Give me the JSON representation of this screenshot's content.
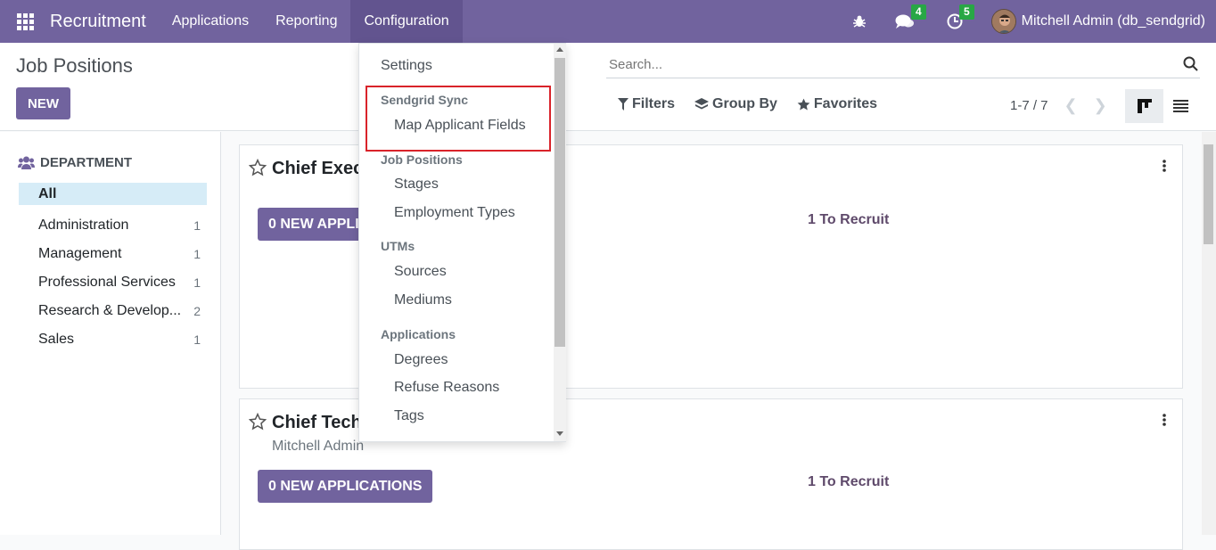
{
  "navbar": {
    "brand": "Recruitment",
    "menus": [
      "Applications",
      "Reporting",
      "Configuration"
    ],
    "messages_count": "4",
    "activities_count": "5",
    "user": "Mitchell Admin (db_sendgrid)"
  },
  "control": {
    "title": "Job Positions",
    "new_label": "NEW",
    "search_placeholder": "Search...",
    "filters": "Filters",
    "group_by": "Group By",
    "favorites": "Favorites",
    "pager": "1-7 / 7"
  },
  "sidebar": {
    "heading": "DEPARTMENT",
    "items": [
      {
        "label": "All",
        "count": ""
      },
      {
        "label": "Administration",
        "count": "1"
      },
      {
        "label": "Management",
        "count": "1"
      },
      {
        "label": "Professional Services",
        "count": "1"
      },
      {
        "label": "Research & Develop...",
        "count": "2"
      },
      {
        "label": "Sales",
        "count": "1"
      }
    ]
  },
  "cards": [
    {
      "title": "Chief Executive Officer",
      "subtitle": "",
      "button": "0 NEW APPLICATIONS",
      "recruit": "1 To Recruit"
    },
    {
      "title": "Chief Technical Officer",
      "subtitle": "Mitchell Admin",
      "button": "0 NEW APPLICATIONS",
      "recruit": "1 To Recruit"
    }
  ],
  "dropdown": {
    "settings": "Settings",
    "sendgrid_head": "Sendgrid Sync",
    "map_fields": "Map Applicant Fields",
    "jobpos_head": "Job Positions",
    "stages": "Stages",
    "employment_types": "Employment Types",
    "utms_head": "UTMs",
    "sources": "Sources",
    "mediums": "Mediums",
    "applications_head": "Applications",
    "degrees": "Degrees",
    "refuse_reasons": "Refuse Reasons",
    "tags": "Tags"
  },
  "colors": {
    "brand": "#71639e",
    "badge": "#28a745",
    "highlight": "#d9232a"
  }
}
